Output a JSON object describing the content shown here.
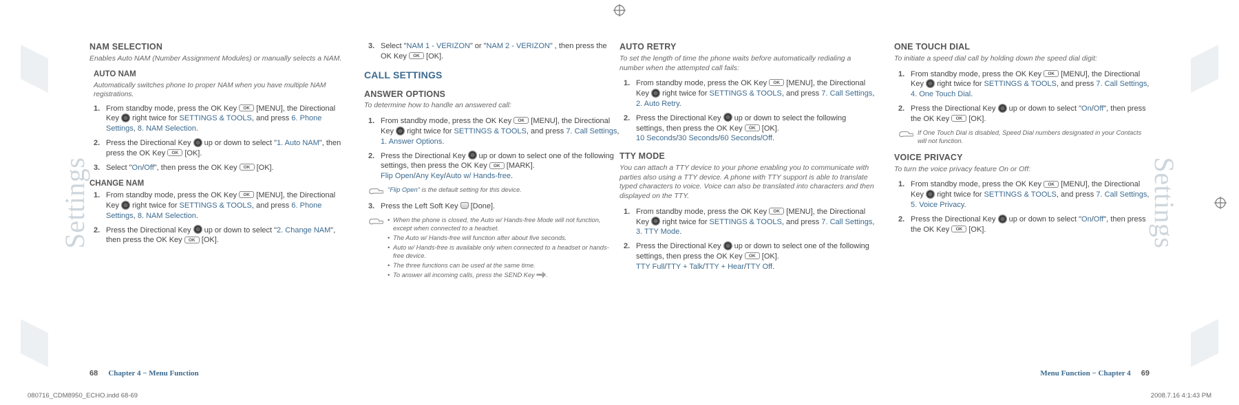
{
  "sideLabel": "Settings",
  "cropGlyph": "⊕",
  "leftPage": {
    "col1": {
      "namSelection": {
        "title": "NAM SELECTION",
        "sub": "Enables Auto NAM (Number Assignment Modules) or manually selects a NAM.",
        "autoNam": {
          "title": "AUTO NAM",
          "sub": "Automatically switches phone to proper NAM when you have multiple NAM registrations.",
          "steps": [
            {
              "before": "From standby mode, press the OK Key ",
              "afterOK": " [MENU], the Directional Key ",
              "afterDir": " right twice for ",
              "l1": "SETTINGS & TOOLS",
              "mid1": ", and press ",
              "l2": "6. Phone Settings",
              "mid2": ", ",
              "l3": "8. NAM Selection",
              "end": "."
            },
            {
              "before": "Press the Directional Key ",
              "afterDir": " up or down to select \"",
              "l1": "1. Auto NAM",
              "mid1": "\", then press the OK Key ",
              "okLabel": " [OK]."
            },
            {
              "before": "Select \"",
              "l1": "On",
              "mid1": "/",
              "l2": "Off",
              "afterLinks": "\", then press the OK Key ",
              "okLabel": " [OK]."
            }
          ]
        },
        "changeNam": {
          "title": "CHANGE NAM",
          "steps": [
            {
              "before": "From standby mode, press the OK Key ",
              "afterOK": " [MENU], the Directional Key ",
              "afterDir": " right twice for ",
              "l1": "SETTINGS & TOOLS",
              "mid1": ", and press ",
              "l2": "6. Phone Settings",
              "mid2": ", ",
              "l3": "8. NAM Selection",
              "end": "."
            },
            {
              "before": "Press the Directional Key ",
              "afterDir": " up or down to select \"",
              "l1": "2. Change NAM",
              "mid1": "\", then press the OK Key ",
              "okLabel": " [OK]."
            }
          ]
        }
      }
    },
    "col2": {
      "step3": {
        "num": "3.",
        "before": "Select \"",
        "l1": "NAM 1 - VERIZON",
        "mid1": "\" or \"",
        "l2": "NAM 2 - VERIZON",
        "after": "\" , then press the OK Key ",
        "okLabel": " [OK]."
      },
      "callSettings": "CALL SETTINGS",
      "answerOptions": {
        "title": "ANSWER OPTIONS",
        "sub": "To determine how to handle an answered call:",
        "steps": [
          {
            "before": "From standby mode, press the OK Key ",
            "afterOK": " [MENU], the Directional Key ",
            "afterDir": " right twice for ",
            "l1": "SETTINGS & TOOLS",
            "mid1": ", and press ",
            "l2": "7. Call Settings",
            "mid2": ", ",
            "l3": "1. Answer Options",
            "end": "."
          },
          {
            "before": "Press the Directional Key ",
            "afterDir": " up or down to select one of the following settings, then press the OK Key ",
            "okLabel": " [MARK].",
            "l1": "Flip Open",
            "mid1": "/",
            "l2": "Any Key",
            "mid2": "/",
            "l3": "Auto w/ Hands-free",
            "end2": "."
          }
        ],
        "note1": {
          "text": "\"",
          "link": "Flip Open",
          "after": "\" is the default setting for this device."
        },
        "step3": {
          "num": "3.",
          "before": "Press the Left Soft Key ",
          "after": " [Done]."
        },
        "note2": [
          "When the phone is closed, the Auto w/ Hands-free Mode will not function, except when connected to a headset.",
          "The Auto w/ Hands-free will function after about five seconds.",
          "Auto w/ Hands-free is available only when connected to a headset or hands-free device.",
          "The three functions can be used at the same time.",
          "To answer all incoming calls, press the SEND Key "
        ],
        "note2end": "."
      }
    },
    "footer": {
      "page": "68",
      "chapter": "Chapter 4 − Menu Function"
    }
  },
  "rightPage": {
    "col1": {
      "autoRetry": {
        "title": "AUTO RETRY",
        "sub": "To set the length of time the phone waits before automatically redialing a number when the attempted call fails:",
        "steps": [
          {
            "before": "From standby mode, press the OK Key ",
            "afterOK": " [MENU], the Directional Key ",
            "afterDir": " right twice for ",
            "l1": "SETTINGS & TOOLS",
            "mid1": ", and press ",
            "l2": "7. Call Settings",
            "mid2": ", ",
            "l3": "2. Auto Retry",
            "end": "."
          },
          {
            "before": "Press the Directional Key ",
            "afterDir": " up or down to select the following settings, then press the OK Key ",
            "okLabel": " [OK].",
            "l1": "10 Seconds",
            "mid1": "/",
            "l2": "30 Seconds",
            "mid2": "/",
            "l3": "60 Seconds",
            "mid3": "/",
            "l4": "Off",
            "end2": "."
          }
        ]
      },
      "ttyMode": {
        "title": "TTY MODE",
        "sub": "You can attach a TTY device to your phone enabling you to communicate with parties also using a TTY device. A phone with TTY support is able to translate typed characters to voice. Voice can also be translated into characters and then displayed on the TTY.",
        "steps": [
          {
            "before": "From standby mode, press the OK Key ",
            "afterOK": " [MENU], the Directional Key ",
            "afterDir": " right twice for ",
            "l1": "SETTINGS & TOOLS",
            "mid1": ", and press ",
            "l2": "7. Call Settings",
            "mid2": ", ",
            "l3": "3. TTY Mode",
            "end": "."
          },
          {
            "before": "Press the Directional Key ",
            "afterDir": " up or down to select one of the following settings, then press the OK Key ",
            "okLabel": " [OK].",
            "l1": "TTY Full",
            "mid1": "/",
            "l2": "TTY + Talk",
            "mid2": "/",
            "l3": "TTY + Hear",
            "mid3": "/",
            "l4": "TTY Off",
            "end2": "."
          }
        ]
      }
    },
    "col2": {
      "oneTouchDial": {
        "title": "ONE TOUCH DIAL",
        "sub": "To initiate a speed dial call by holding down the speed dial digit:",
        "steps": [
          {
            "before": "From standby mode, press the OK Key ",
            "afterOK": " [MENU], the Directional Key ",
            "afterDir": " right twice for ",
            "l1": "SETTINGS & TOOLS",
            "mid1": ", and press ",
            "l2": "7. Call Settings",
            "mid2": ", ",
            "l3": "4. One Touch Dial",
            "end": "."
          },
          {
            "before": "Press the Directional Key ",
            "afterDir": " up or down to select \"",
            "l1": "On",
            "mid1": "/",
            "l2": "Off",
            "afterLinks": "\", then press the OK Key ",
            "okLabel": " [OK]."
          }
        ],
        "note": "If One Touch Dial is disabled, Speed Dial numbers designated in your Contacts will not function."
      },
      "voicePrivacy": {
        "title": "VOICE PRIVACY",
        "sub": "To turn the voice privacy feature On or Off:",
        "steps": [
          {
            "before": "From standby mode, press the OK Key ",
            "afterOK": " [MENU], the Directional Key ",
            "afterDir": " right twice for ",
            "l1": "SETTINGS & TOOLS",
            "mid1": ", and press ",
            "l2": "7. Call Settings",
            "mid2": ", ",
            "l3": "5. Voice Privacy",
            "end": "."
          },
          {
            "before": "Press the Directional Key ",
            "afterDir": " up or down to select \"",
            "l1": "On",
            "mid1": "/",
            "l2": "Off",
            "afterLinks": "\", then press the OK Key ",
            "okLabel": " [OK]."
          }
        ]
      }
    },
    "footer": {
      "chapter": "Menu Function − Chapter 4",
      "page": "69"
    }
  },
  "slug": {
    "file": "080716_CDM8950_ECHO.indd   68-69",
    "time": "2008.7.16   4:1:43 PM"
  },
  "okGlyph": "OK"
}
